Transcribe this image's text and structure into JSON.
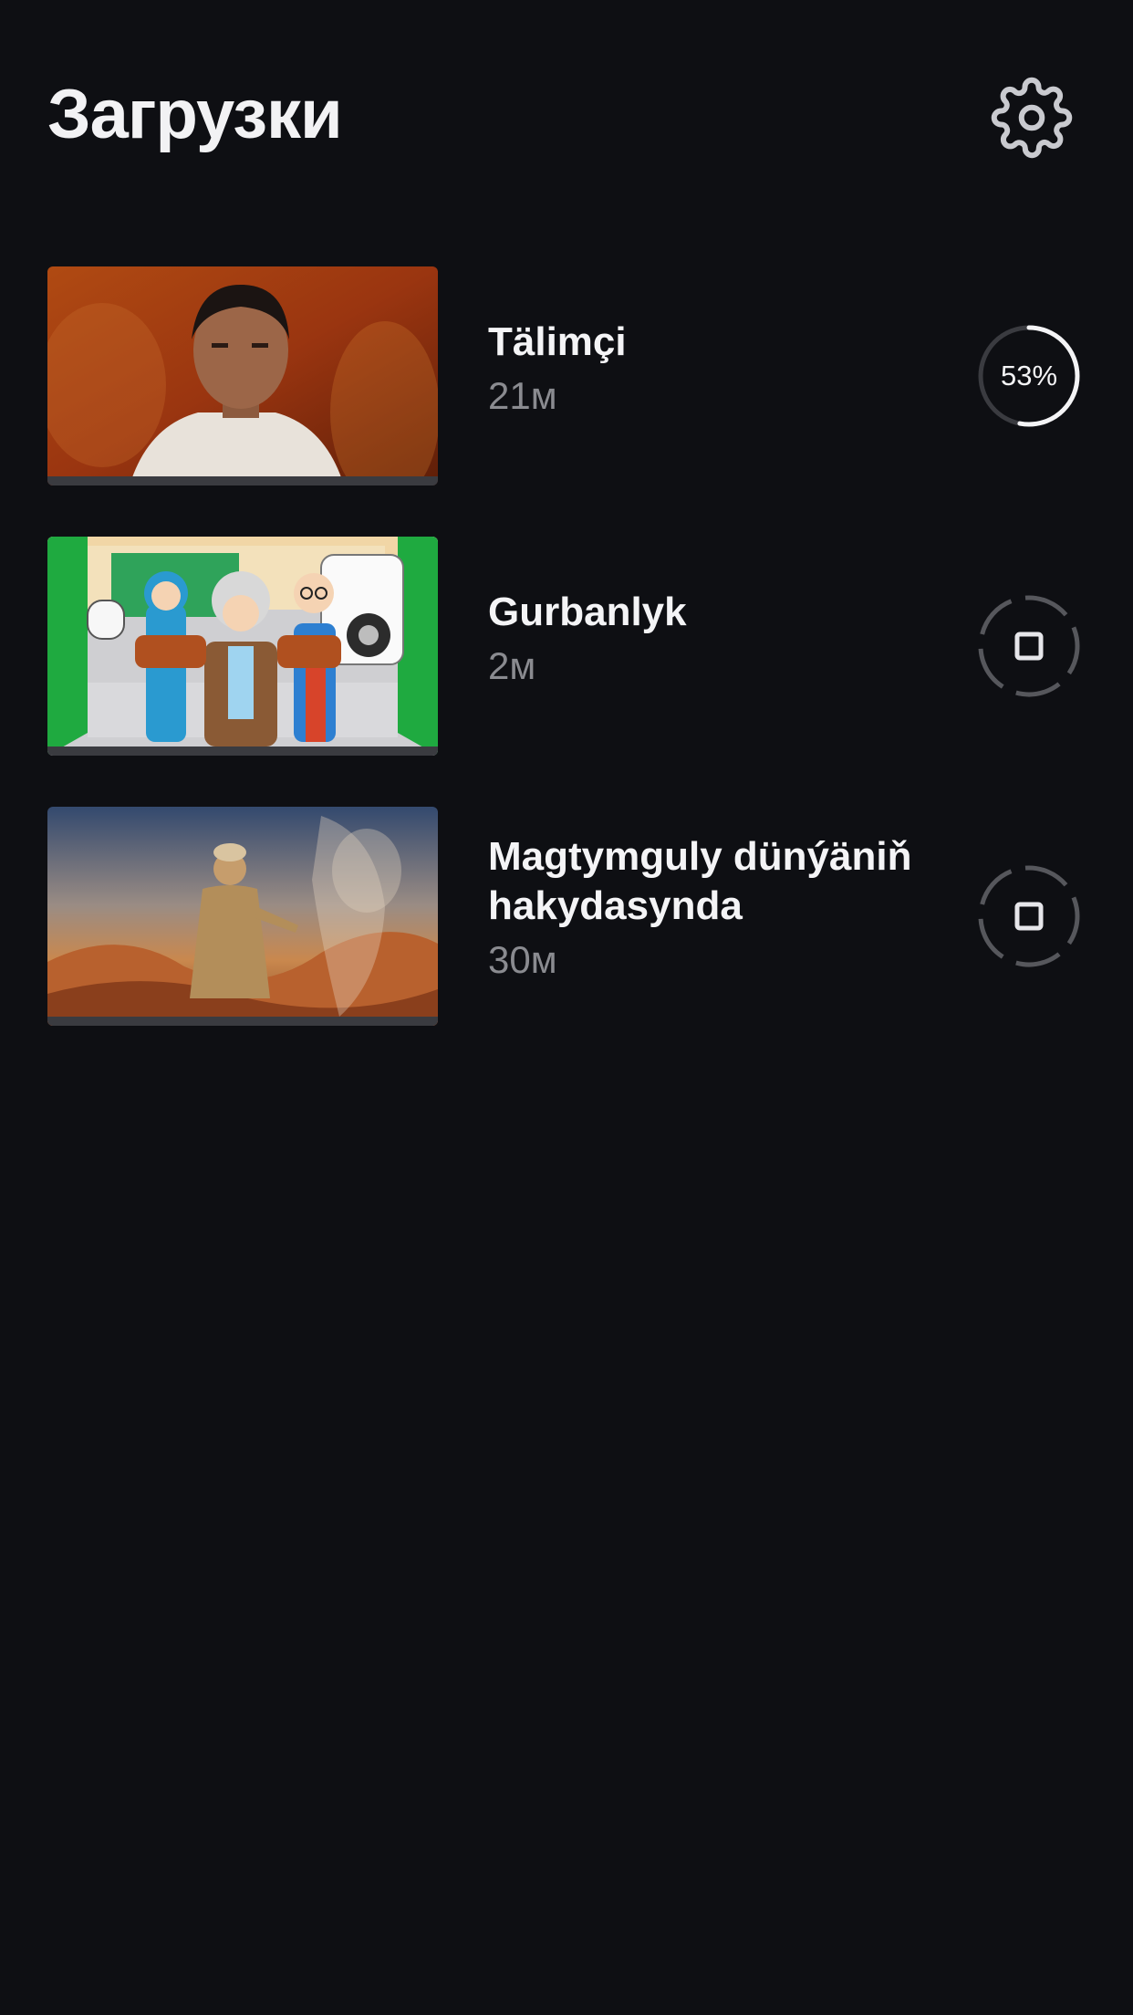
{
  "header": {
    "title": "Загрузки",
    "settings_icon": "gear-icon"
  },
  "colors": {
    "background": "#0e0f13",
    "text_primary": "#f4f4f6",
    "text_secondary": "#8a8b90",
    "ring_track": "#3a3b40",
    "ring_active": "#f4f4f6"
  },
  "downloads": [
    {
      "title": "Tälimçi",
      "duration": "21м",
      "status": "downloading",
      "progress_label": "53%",
      "progress": 0.53
    },
    {
      "title": "Gurbanlyk",
      "duration": "2м",
      "status": "queued",
      "status_icon": "stop-icon"
    },
    {
      "title": "Magtymguly dünýäniň hakydasynda",
      "duration": "30м",
      "status": "queued",
      "status_icon": "stop-icon"
    }
  ]
}
